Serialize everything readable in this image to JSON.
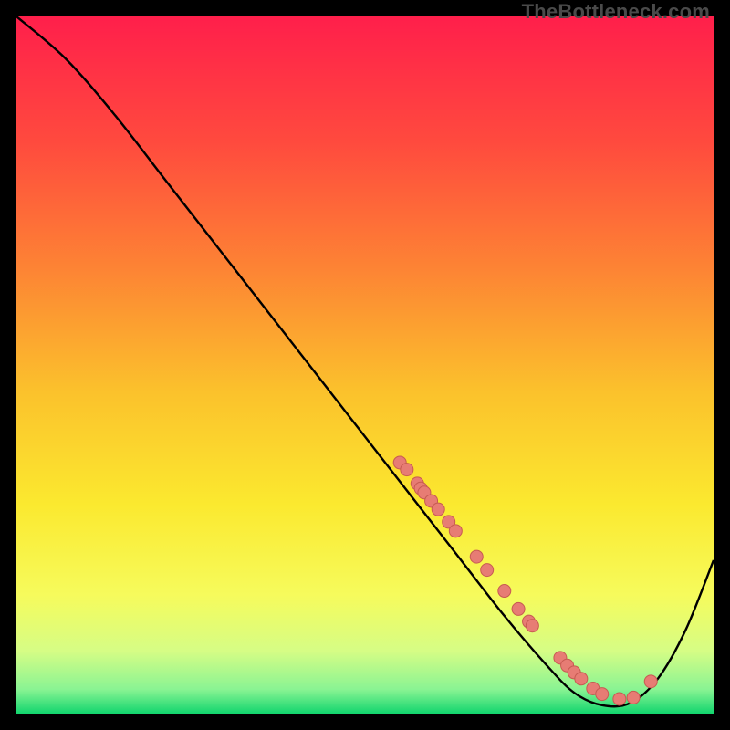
{
  "watermark": "TheBottleneck.com",
  "chart_data": {
    "type": "line",
    "title": "",
    "xlabel": "",
    "ylabel": "",
    "xlim": [
      0,
      100
    ],
    "ylim": [
      0,
      100
    ],
    "series": [
      {
        "name": "curve",
        "x": [
          0,
          7,
          14,
          21,
          28,
          35,
          42,
          49,
          56,
          63,
          70,
          76,
          80,
          84,
          88,
          92,
          96,
          100
        ],
        "y": [
          100,
          94,
          86,
          77,
          68,
          59,
          50,
          41,
          32,
          23,
          14,
          7,
          3,
          1.2,
          1.5,
          5,
          12,
          22
        ]
      }
    ],
    "markers": {
      "x": [
        55,
        56,
        57.5,
        58,
        58.5,
        59.5,
        60.5,
        62,
        63,
        66,
        67.5,
        70,
        72,
        73.5,
        74,
        78,
        79,
        80,
        81,
        82.7,
        84,
        86.5,
        88.5,
        91
      ],
      "y": [
        36,
        35,
        33,
        32.3,
        31.7,
        30.5,
        29.3,
        27.5,
        26.2,
        22.5,
        20.6,
        17.6,
        15,
        13.2,
        12.6,
        8,
        6.9,
        5.9,
        5,
        3.6,
        2.8,
        2.1,
        2.3,
        4.6
      ]
    },
    "gradient_stops": [
      {
        "offset": 0.0,
        "color": "#ff1f4b"
      },
      {
        "offset": 0.18,
        "color": "#ff4a3e"
      },
      {
        "offset": 0.36,
        "color": "#fd8334"
      },
      {
        "offset": 0.54,
        "color": "#fbc22c"
      },
      {
        "offset": 0.7,
        "color": "#fbe92f"
      },
      {
        "offset": 0.83,
        "color": "#f6fb5c"
      },
      {
        "offset": 0.91,
        "color": "#d6fd85"
      },
      {
        "offset": 0.965,
        "color": "#8af493"
      },
      {
        "offset": 1.0,
        "color": "#12d56e"
      }
    ],
    "marker_style": {
      "fill": "#e77c74",
      "stroke": "#c75a52",
      "r": 7
    },
    "curve_stroke": "#000000",
    "curve_width": 2.4
  }
}
